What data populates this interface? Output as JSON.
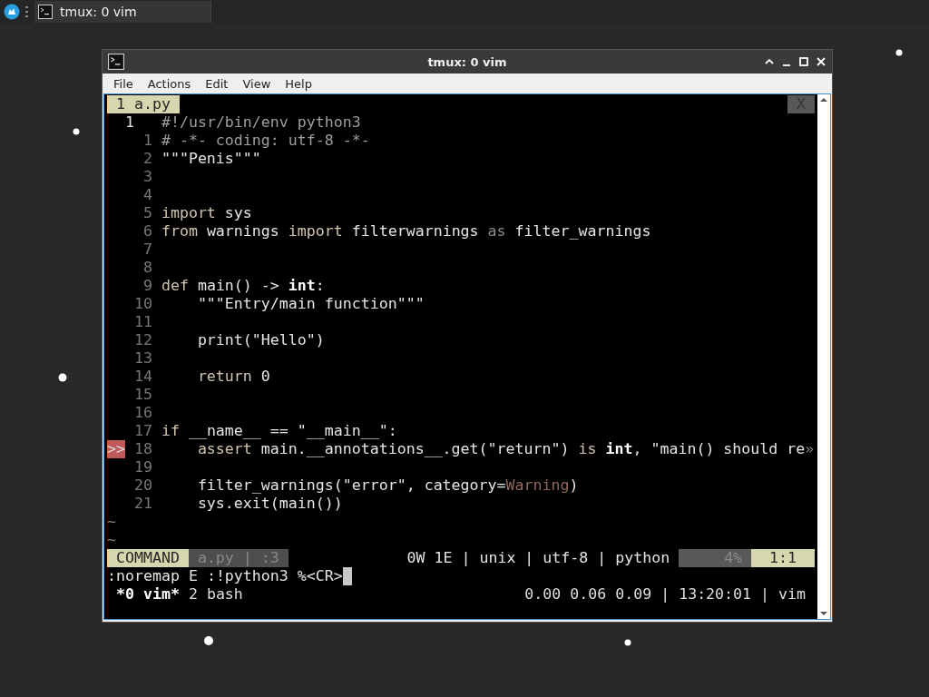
{
  "taskbar": {
    "task": {
      "title": "tmux: 0 vim"
    }
  },
  "window": {
    "title": "tmux: 0 vim",
    "menu": [
      "File",
      "Actions",
      "Edit",
      "View",
      "Help"
    ],
    "terminal": {
      "tab": {
        "label": "1 a.py",
        "selected": true
      },
      "tab_close": "X",
      "header": {
        "number": "1",
        "text": "#!/usr/bin/env python3"
      },
      "lines": [
        {
          "number": "1",
          "segments": [
            {
              "text": "# -*- coding: utf-8 -*-",
              "kind": "comment"
            }
          ]
        },
        {
          "number": "2",
          "segments": [
            {
              "text": "\"\"\"Penis\"\"\"",
              "kind": "plain"
            }
          ]
        },
        {
          "number": "3"
        },
        {
          "number": "4"
        },
        {
          "number": "5",
          "segments": [
            {
              "text": "import",
              "kind": "keyword"
            },
            {
              "text": " sys",
              "kind": "plain"
            }
          ]
        },
        {
          "number": "6",
          "segments": [
            {
              "text": "from",
              "kind": "keyword"
            },
            {
              "text": " warnings ",
              "kind": "plain"
            },
            {
              "text": "import",
              "kind": "keyword"
            },
            {
              "text": " filterwarnings ",
              "kind": "plain"
            },
            {
              "text": "as",
              "kind": "dim"
            },
            {
              "text": " filter_warnings",
              "kind": "plain"
            }
          ]
        },
        {
          "number": "7"
        },
        {
          "number": "8"
        },
        {
          "number": "9",
          "segments": [
            {
              "text": "def",
              "kind": "keyword"
            },
            {
              "text": " main() -> ",
              "kind": "plain"
            },
            {
              "text": "int",
              "kind": "bold"
            },
            {
              "text": ":",
              "kind": "plain"
            }
          ]
        },
        {
          "number": "10",
          "segments": [
            {
              "text": "    \"\"\"Entry/main function\"\"\"",
              "kind": "plain"
            }
          ]
        },
        {
          "number": "11"
        },
        {
          "number": "12",
          "segments": [
            {
              "text": "    print(\"Hello\")",
              "kind": "plain"
            }
          ]
        },
        {
          "number": "13"
        },
        {
          "number": "14",
          "segments": [
            {
              "text": "    return",
              "kind": "keyword"
            },
            {
              "text": " 0",
              "kind": "plain"
            }
          ]
        },
        {
          "number": "15"
        },
        {
          "number": "16"
        },
        {
          "number": "17",
          "segments": [
            {
              "text": "if",
              "kind": "keyword"
            },
            {
              "text": " __name__ == \"__main__\":",
              "kind": "plain"
            }
          ]
        },
        {
          "number": "18",
          "sign": ">>",
          "segments": [
            {
              "text": "    assert",
              "kind": "keyword"
            },
            {
              "text": " main.__annotations__.get(\"return\") ",
              "kind": "plain"
            },
            {
              "text": "is ",
              "kind": "keyword"
            },
            {
              "text": "int",
              "kind": "bold"
            },
            {
              "text": ", \"main() should re",
              "kind": "plain"
            },
            {
              "text": "»",
              "kind": "dim"
            }
          ]
        },
        {
          "number": "19"
        },
        {
          "number": "20",
          "segments": [
            {
              "text": "    filter_warnings(\"error\", category=",
              "kind": "plain"
            },
            {
              "text": "Warning",
              "kind": "builtin"
            },
            {
              "text": ")",
              "kind": "plain"
            }
          ]
        },
        {
          "number": "21",
          "segments": [
            {
              "text": "    sys.exit(main())",
              "kind": "plain"
            }
          ]
        }
      ],
      "tildes": [
        "~",
        "~"
      ],
      "statusline": [
        {
          "text": "COMMAND",
          "kind": "mode"
        },
        {
          "text": "a.py | :3",
          "kind": "file"
        },
        {
          "text": "0W 1E | unix | utf-8 | python",
          "kind": "info"
        },
        {
          "text": "4%",
          "kind": "percent"
        },
        {
          "text": "1:1",
          "kind": "position"
        }
      ],
      "command": ":noremap E :!python3 %<CR>",
      "tmux": {
        "windows": [
          {
            "label": "*0 vim*",
            "selected": true
          },
          {
            "label": "2 bash",
            "selected": false
          }
        ],
        "right": "0.00 0.06 0.09 | 13:20:01 | vim"
      }
    }
  }
}
